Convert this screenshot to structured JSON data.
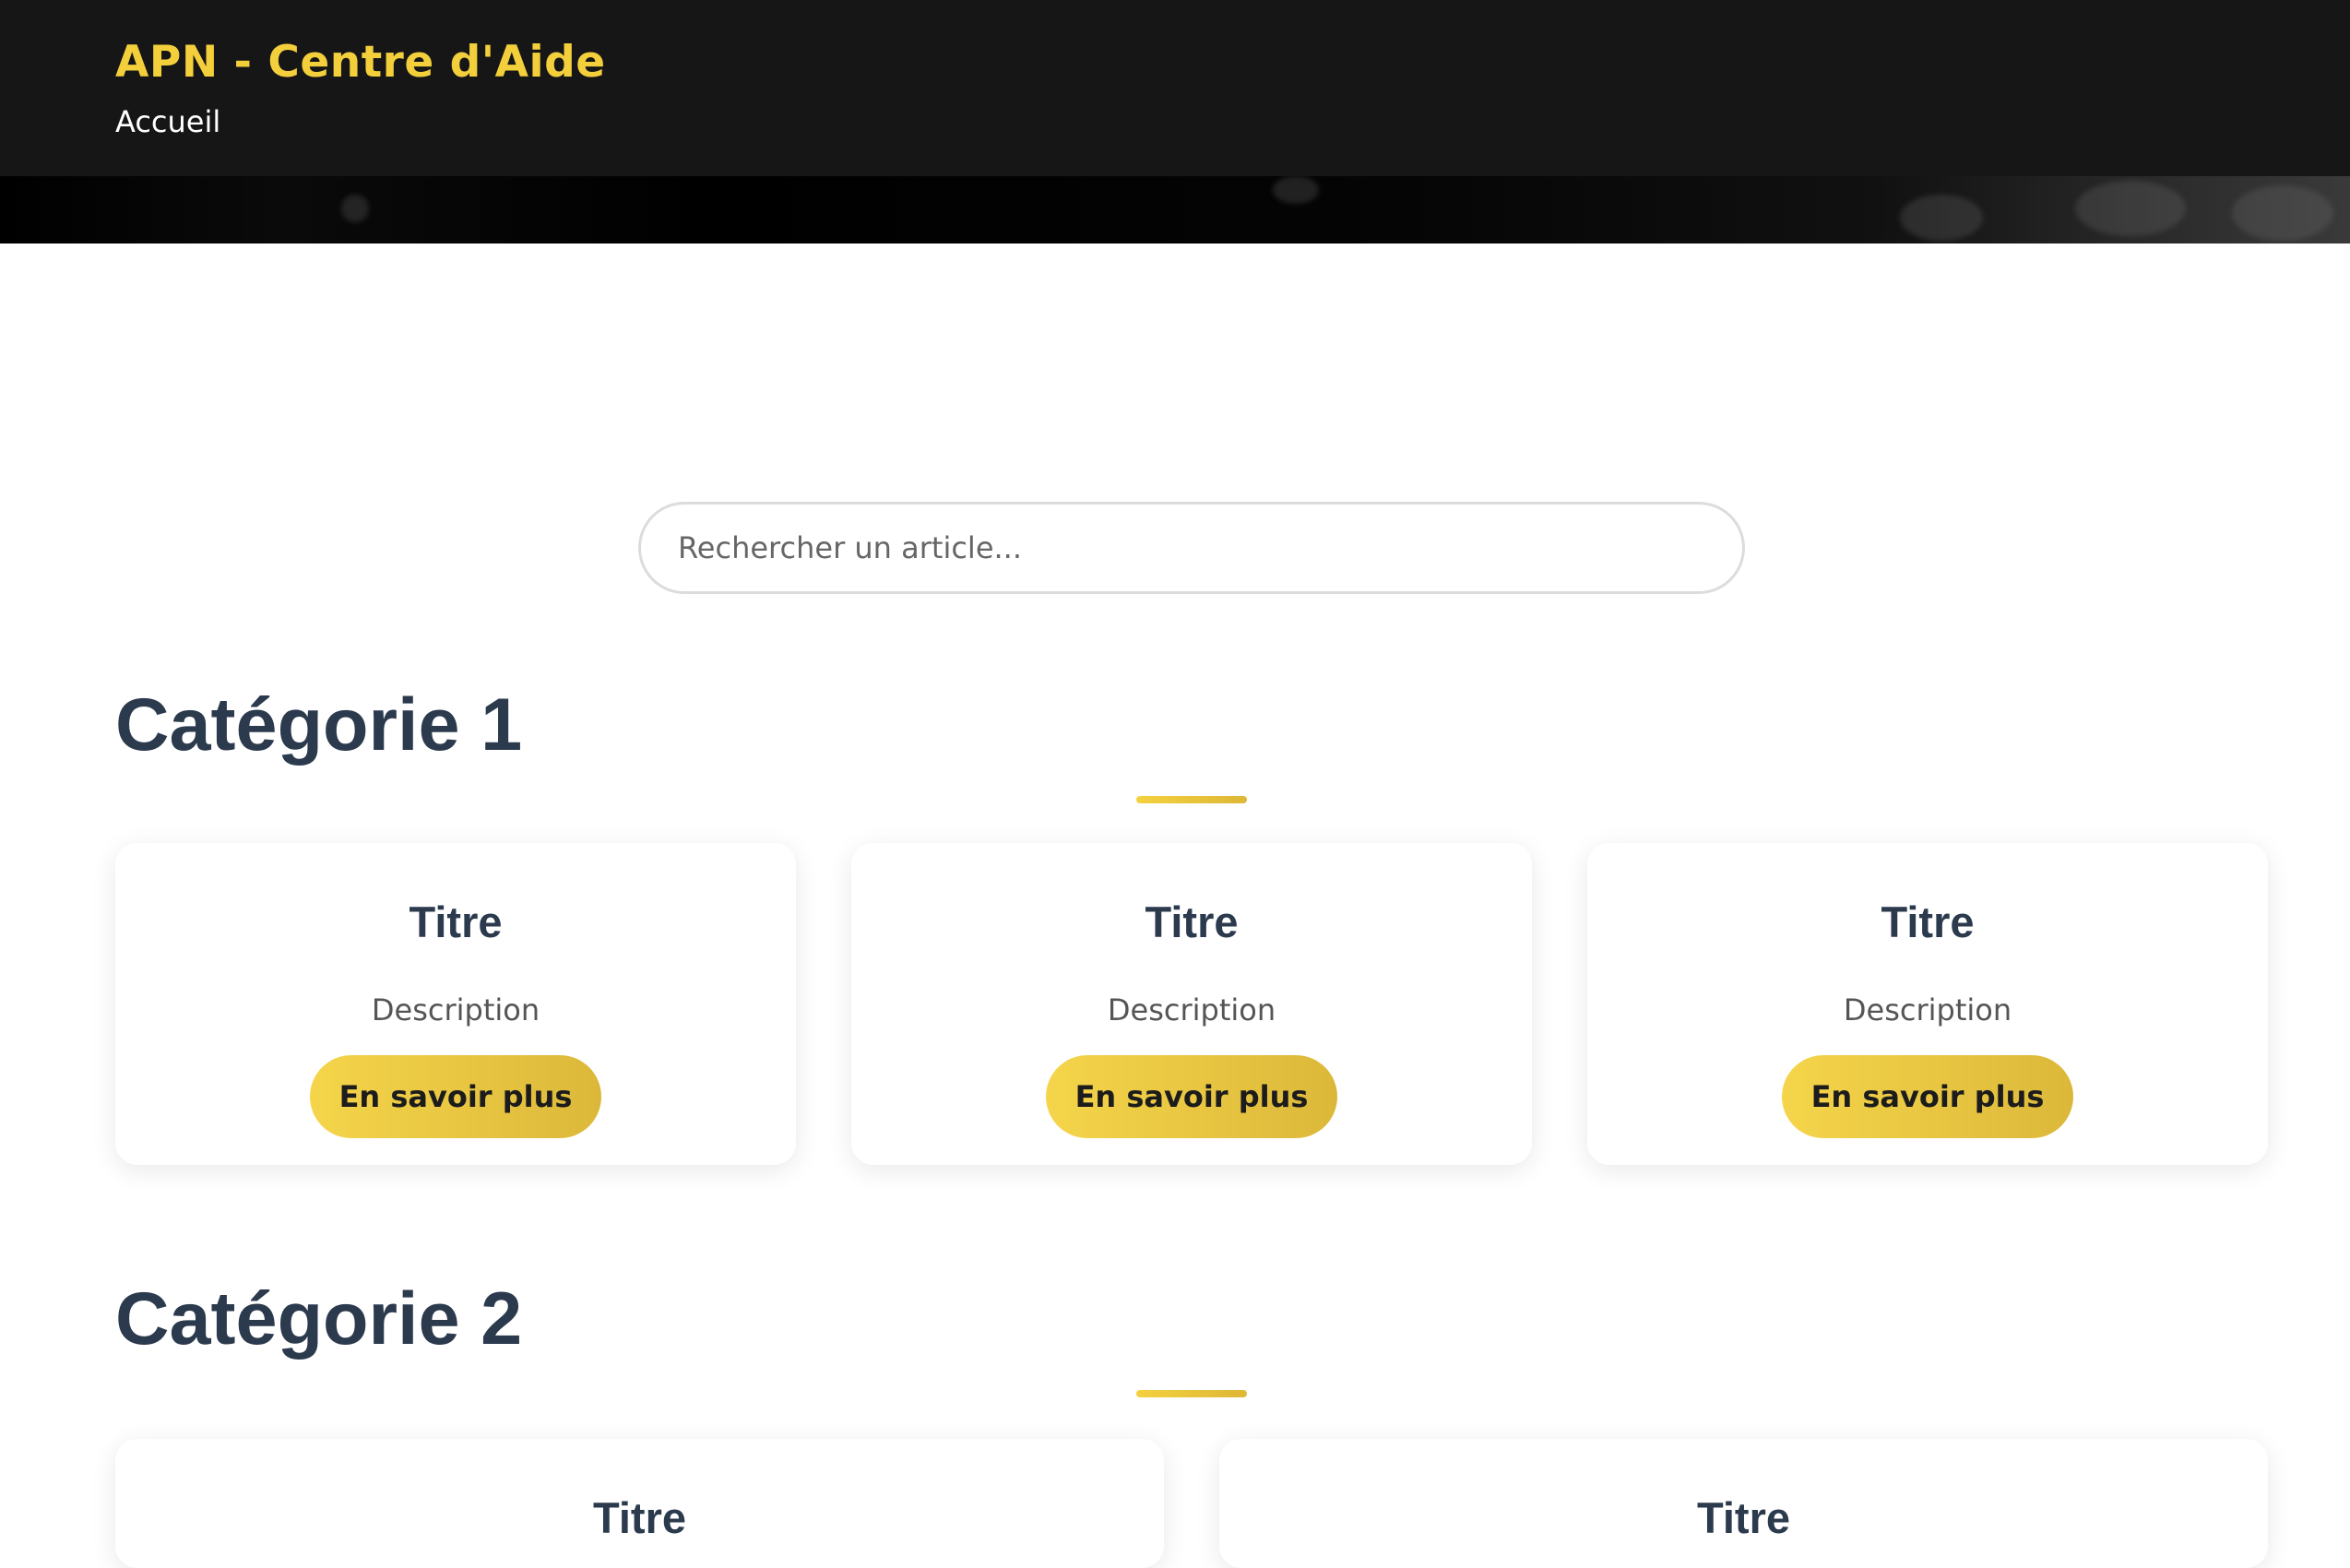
{
  "header": {
    "brand": "APN - Centre d'Aide",
    "nav_home": "Accueil"
  },
  "search": {
    "placeholder": "Rechercher un article..."
  },
  "categories": [
    {
      "title": "Catégorie 1",
      "cards": [
        {
          "title": "Titre",
          "description": "Description",
          "button": "En savoir plus"
        },
        {
          "title": "Titre",
          "description": "Description",
          "button": "En savoir plus"
        },
        {
          "title": "Titre",
          "description": "Description",
          "button": "En savoir plus"
        }
      ]
    },
    {
      "title": "Catégorie 2",
      "cards": [
        {
          "title": "Titre"
        },
        {
          "title": "Titre"
        }
      ]
    }
  ],
  "colors": {
    "accent": "#f4cf3c",
    "heading": "#2c3a4e",
    "topbar": "#161616"
  }
}
